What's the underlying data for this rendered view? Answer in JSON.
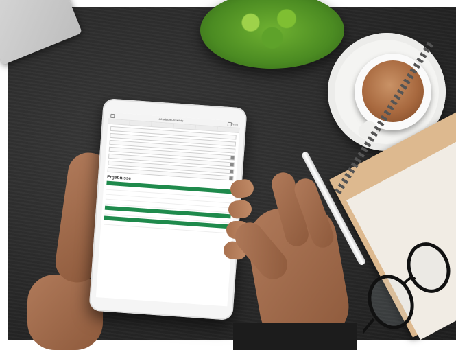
{
  "scene": {
    "desk_color": "#2a2a2a",
    "accent_green": "#1f8a4c"
  },
  "tablet": {
    "browser": {
      "url": "schadstoffe-praxis.de",
      "right_label": "Fertig",
      "tabs": [
        "",
        "",
        "",
        "",
        "",
        ""
      ]
    },
    "form": {
      "fields": [
        {
          "label": "",
          "type": "text"
        },
        {
          "label": "",
          "type": "text"
        },
        {
          "label": "",
          "type": "text"
        },
        {
          "label": "",
          "type": "select"
        },
        {
          "label": "",
          "type": "select"
        },
        {
          "label": "",
          "type": "select"
        },
        {
          "label": "",
          "type": "select"
        }
      ]
    },
    "results": {
      "title": "Ergebnisse",
      "sections": [
        {
          "header": "",
          "rows": [
            {
              "k": "",
              "v": ""
            },
            {
              "k": "",
              "v": ""
            },
            {
              "k": "",
              "v": ""
            },
            {
              "k": "",
              "v": ""
            }
          ]
        },
        {
          "header": "",
          "rows": [
            {
              "k": "",
              "v": ""
            }
          ]
        },
        {
          "header": "",
          "rows": [
            {
              "k": "",
              "v": ""
            }
          ]
        }
      ],
      "footer": ""
    }
  }
}
